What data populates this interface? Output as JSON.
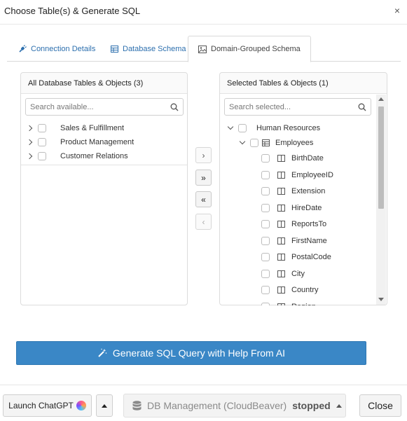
{
  "dialog": {
    "title": "Choose Table(s) & Generate SQL",
    "close_glyph": "×"
  },
  "tabs": [
    {
      "label": "Connection Details",
      "icon": "plug-icon",
      "active": false
    },
    {
      "label": "Database Schema",
      "icon": "table-icon",
      "active": false
    },
    {
      "label": "Domain-Grouped Schema",
      "icon": "image-icon",
      "active": true
    }
  ],
  "available": {
    "header": "All Database Tables & Objects (3)",
    "search_placeholder": "Search available...",
    "items": [
      {
        "label": "Sales & Fulfillment"
      },
      {
        "label": "Product Management"
      },
      {
        "label": "Customer Relations"
      }
    ]
  },
  "movers": {
    "move_right": "›",
    "move_all_right": "»",
    "move_all_left": "«",
    "move_left": "‹"
  },
  "selected": {
    "header": "Selected Tables & Objects (1)",
    "search_placeholder": "Search selected...",
    "group": "Human Resources",
    "table": "Employees",
    "columns": [
      "BirthDate",
      "EmployeeID",
      "Extension",
      "HireDate",
      "ReportsTo",
      "FirstName",
      "PostalCode",
      "City",
      "Country",
      "Region"
    ]
  },
  "generate_button": {
    "label": "Generate SQL Query with Help From AI",
    "icon": "magic-wand-icon"
  },
  "footer": {
    "launch_chatgpt": "Launch ChatGPT",
    "db_management_label": "DB Management (CloudBeaver)",
    "db_status": "stopped",
    "close": "Close"
  },
  "colors": {
    "accent": "#3a87c6",
    "link": "#2c6fae"
  }
}
